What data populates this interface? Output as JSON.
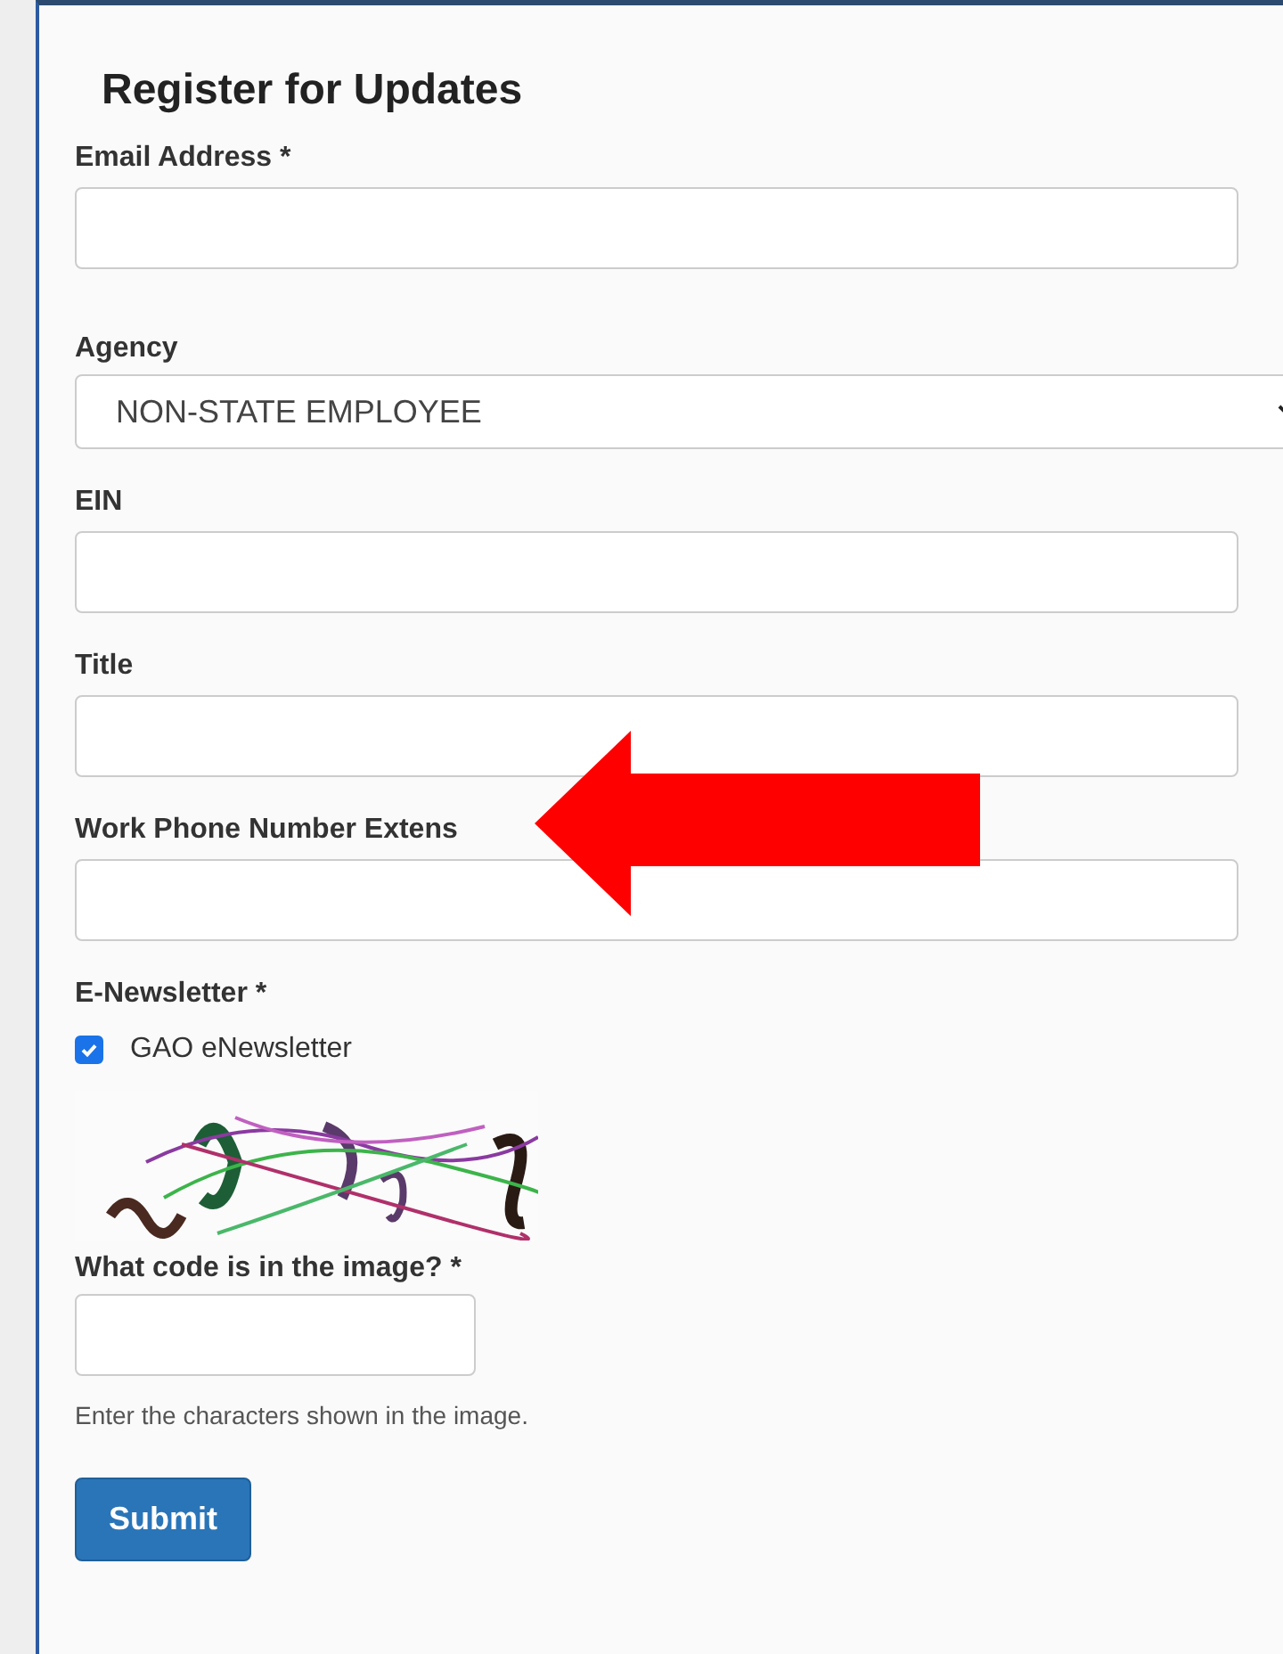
{
  "form": {
    "title": "Register for Updates",
    "fields": [
      {
        "kind": "text",
        "label": "Email Address *"
      },
      {
        "kind": "select",
        "label": "Agency",
        "value": "NON-STATE EMPLOYEE"
      },
      {
        "kind": "text",
        "label": "EIN"
      },
      {
        "kind": "text",
        "label": "Title"
      },
      {
        "kind": "text",
        "label": "Work Phone Number Extens"
      }
    ],
    "newsletter": {
      "label": "E-Newsletter *",
      "option": "GAO eNewsletter",
      "checked": true
    },
    "captcha": {
      "label": "What code is in the image? *",
      "help": "Enter the characters shown in the image."
    },
    "submit": "Submit"
  }
}
